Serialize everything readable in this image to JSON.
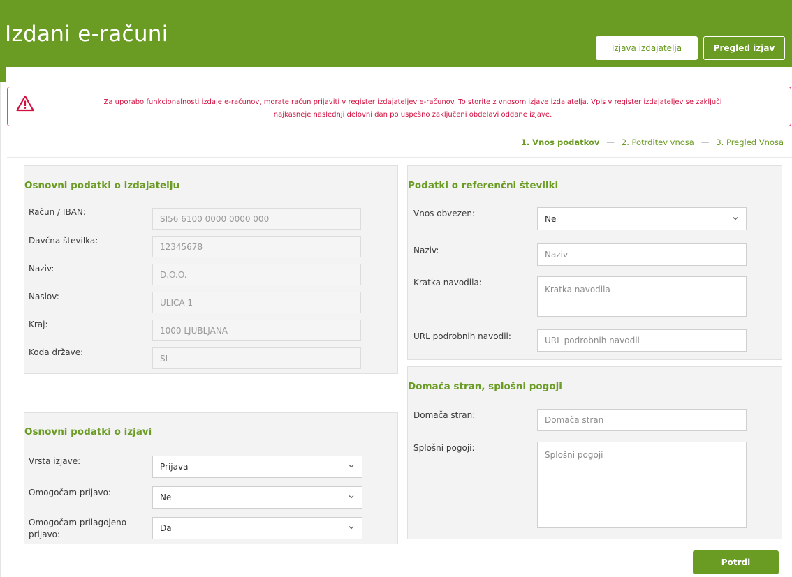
{
  "header": {
    "title": "Izdani e-računi",
    "buttons": {
      "issuer_statement": "Izjava izdajatelja",
      "review_statements": "Pregled izjav"
    }
  },
  "alert": {
    "icon": "warning-icon",
    "line1": "Za uporabo funkcionalnosti izdaje e-računov, morate račun prijaviti v register izdajateljev e-računov. To storite z vnosom izjave izdajatelja. Vpis v register izdajateljev se zaključi",
    "line2": "najkasneje naslednji delovni dan po uspešno zaključeni obdelavi oddane izjave."
  },
  "steps": {
    "step1": "1. Vnos podatkov",
    "step2": "2. Potrditev vnosa",
    "step3": "3. Pregled Vnosa",
    "separator": "—"
  },
  "issuer": {
    "title": "Osnovni podatki o izdajatelju",
    "fields": [
      {
        "label": "Račun / IBAN:",
        "value": "SI56 6100 0000 0000 000"
      },
      {
        "label": "Davčna številka:",
        "value": "12345678"
      },
      {
        "label": "Naziv:",
        "value": "D.O.O."
      },
      {
        "label": "Naslov:",
        "value": "ULICA 1"
      },
      {
        "label": "Kraj:",
        "value": "1000 LJUBLJANA"
      },
      {
        "label": "Koda države:",
        "value": "SI"
      }
    ]
  },
  "statement": {
    "title": "Osnovni podatki o izjavi",
    "fields": [
      {
        "label": "Vrsta izjave:",
        "value": "Prijava"
      },
      {
        "label": "Omogočam prijavo:",
        "value": "Ne"
      },
      {
        "label": "Omogočam prilagojeno prijavo:",
        "value": "Da"
      }
    ]
  },
  "reference": {
    "title": "Podatki o referenčni številki",
    "required_label": "Vnos obvezen:",
    "required_value": "Ne",
    "name_label": "Naziv:",
    "name_placeholder": "Naziv",
    "short_label": "Kratka navodila:",
    "short_placeholder": "Kratka navodila",
    "url_label": "URL podrobnih navodil:",
    "url_placeholder": "URL podrobnih navodil"
  },
  "homepage": {
    "title": "Domača stran, splošni pogoji",
    "home_label": "Domača stran:",
    "home_placeholder": "Domača stran",
    "terms_label": "Splošni pogoji:",
    "terms_placeholder": "Splošni pogoji"
  },
  "actions": {
    "confirm": "Potrdi"
  },
  "colors": {
    "brand_green": "#6a9b23",
    "alert_red": "#d1103f"
  }
}
